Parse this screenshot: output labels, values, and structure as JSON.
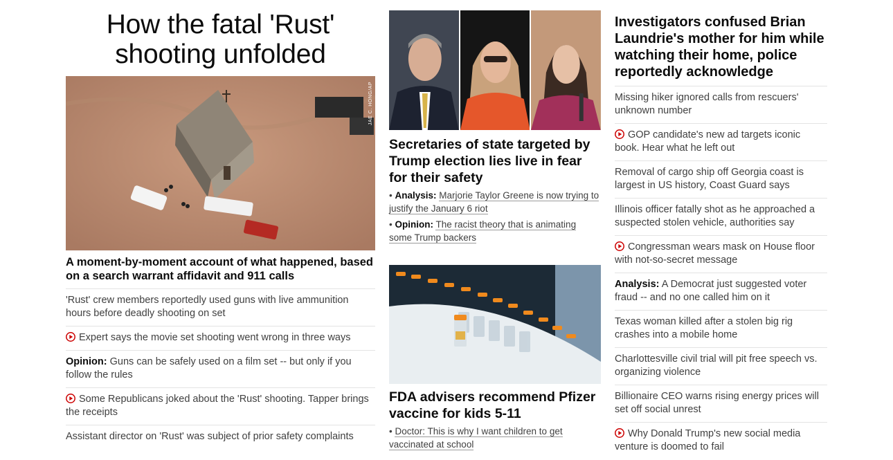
{
  "left": {
    "title": "How the fatal 'Rust' shooting unfolded",
    "photo_credit": "JAE C. HONG/AP",
    "subheadline": "A moment-by-moment account of what happened, based on a search warrant affidavit and 911 calls",
    "items": [
      {
        "prefix": "",
        "text": "'Rust' crew members reportedly used guns with live ammunition hours before deadly shooting on set",
        "video": false
      },
      {
        "prefix": "",
        "text": "Expert says the movie set shooting went wrong in three ways",
        "video": true
      },
      {
        "prefix": "Opinion:",
        "text": " Guns can be safely used on a film set -- but only if you follow the rules",
        "video": false
      },
      {
        "prefix": "",
        "text": "Some Republicans joked about the 'Rust' shooting. Tapper brings the receipts",
        "video": true
      },
      {
        "prefix": "",
        "text": "Assistant director on 'Rust' was subject of prior safety complaints",
        "video": false
      }
    ]
  },
  "middle": {
    "story1": {
      "title": "Secretaries of state targeted by Trump election lies live in fear for their safety",
      "bullets": [
        {
          "prefix": "Analysis:",
          "text": "Marjorie Taylor Greene is now trying to justify the January 6 riot"
        },
        {
          "prefix": "Opinion:",
          "text": "The racist theory that is animating some Trump backers"
        }
      ]
    },
    "story2": {
      "title": "FDA advisers recommend Pfizer vaccine for kids 5-11",
      "bullets": [
        {
          "prefix": "",
          "text": "Doctor: This is why I want children to get vaccinated at school"
        }
      ]
    }
  },
  "right": {
    "lead": "Investigators confused Brian Laundrie's mother for him while watching their home, police reportedly acknowledge",
    "items": [
      {
        "prefix": "",
        "text": "Missing hiker ignored calls from rescuers' unknown number",
        "video": false
      },
      {
        "prefix": "",
        "text": "GOP candidate's new ad targets iconic book. Hear what he left out",
        "video": true
      },
      {
        "prefix": "",
        "text": "Removal of cargo ship off Georgia coast is largest in US history, Coast Guard says",
        "video": false
      },
      {
        "prefix": "",
        "text": "Illinois officer fatally shot as he approached a suspected stolen vehicle, authorities say",
        "video": false
      },
      {
        "prefix": "",
        "text": "Congressman wears mask on House floor with not-so-secret message",
        "video": true
      },
      {
        "prefix": "Analysis:",
        "text": " A Democrat just suggested voter fraud -- and no one called him on it",
        "video": false
      },
      {
        "prefix": "",
        "text": "Texas woman killed after a stolen big rig crashes into a mobile home",
        "video": false
      },
      {
        "prefix": "",
        "text": "Charlottesville civil trial will pit free speech vs. organizing violence",
        "video": false
      },
      {
        "prefix": "",
        "text": "Billionaire CEO warns rising energy prices will set off social unrest",
        "video": false
      },
      {
        "prefix": "",
        "text": "Why Donald Trump's new social media venture is doomed to fail",
        "video": true
      }
    ]
  },
  "colors": {
    "accent_red": "#cc0000",
    "divider": "#e3e3e3"
  },
  "icons": {
    "video": "play-circle-icon"
  }
}
